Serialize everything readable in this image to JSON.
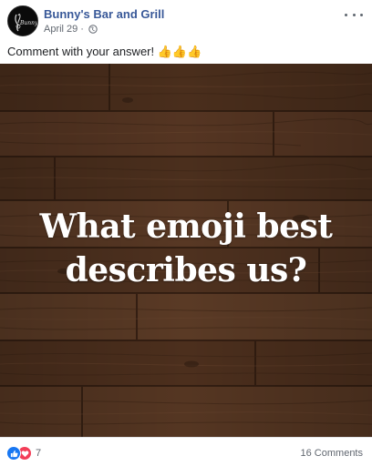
{
  "post": {
    "page_name": "Bunny's Bar and Grill",
    "avatar_text": "Bunny's",
    "date": "April 29",
    "separator": "·",
    "audience_icon": "globe-icon",
    "more_icon": "more-options-icon",
    "text": "Comment with your answer! 👍👍👍"
  },
  "image": {
    "line1": "What emoji best",
    "line2": "describes us?",
    "background": "wood-planks"
  },
  "footer": {
    "reaction_icons": [
      "like-icon",
      "love-icon"
    ],
    "reaction_count": "7",
    "comments": "16 Comments"
  },
  "colors": {
    "link": "#385898",
    "meta": "#616770",
    "like": "#1877f2",
    "love": "#f33e58",
    "wood_dark": "#3a2415",
    "wood_mid": "#553521"
  }
}
